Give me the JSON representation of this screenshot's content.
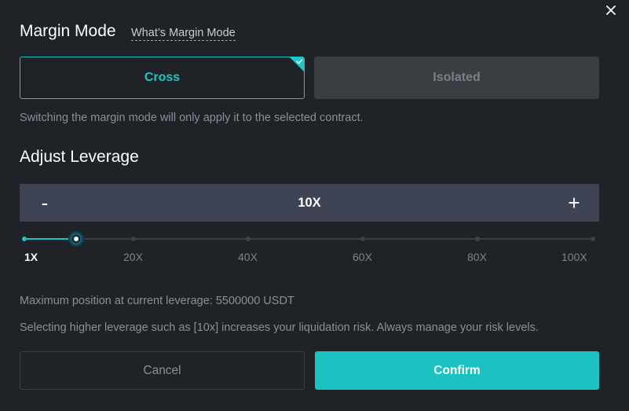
{
  "margin": {
    "title": "Margin Mode",
    "help_link": "What’s Margin Mode",
    "options": [
      "Cross",
      "Isolated"
    ],
    "selected": "Cross",
    "note": "Switching the margin mode will only apply it to the selected contract."
  },
  "leverage": {
    "title": "Adjust Leverage",
    "minus": "-",
    "plus": "+",
    "value": "10X",
    "ticks": [
      "1X",
      "20X",
      "40X",
      "60X",
      "80X",
      "100X"
    ],
    "slider_value": 10,
    "slider_min": 1,
    "slider_max": 100,
    "max_position": "Maximum position at current leverage: 5500000 USDT",
    "risk_note": "Selecting higher leverage such as [10x] increases your liquidation risk. Always manage your risk levels."
  },
  "actions": {
    "cancel": "Cancel",
    "confirm": "Confirm"
  },
  "icons": {
    "close": "close-icon",
    "selected_check": "check-icon"
  },
  "colors": {
    "accent": "#20c4c4",
    "background": "#1f2227",
    "leverage_box": "#3f4454"
  }
}
